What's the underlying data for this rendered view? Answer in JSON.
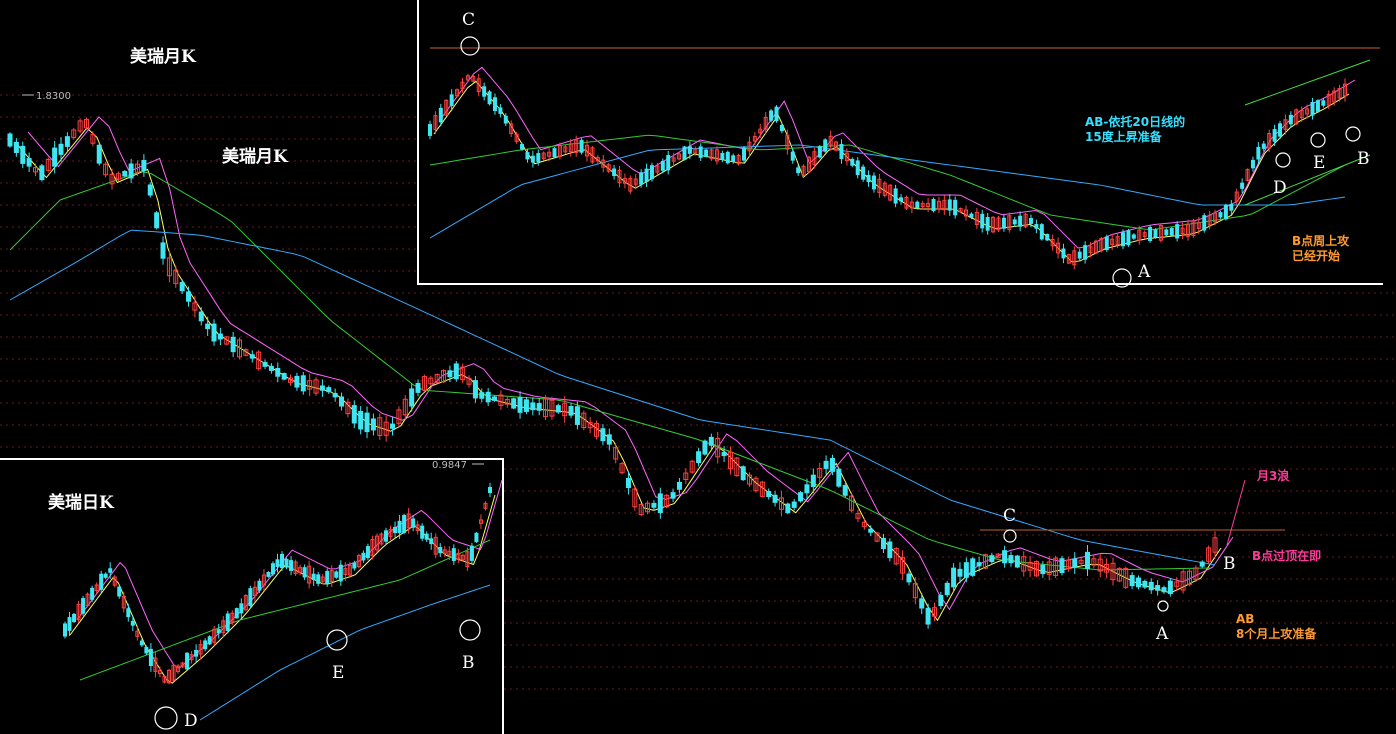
{
  "colors": {
    "background": "#000000",
    "grid": "#6b1a1a",
    "up_candle": "#ff4040",
    "down_candle": "#3fe6f2",
    "ma5": "#ffffff",
    "ma10": "#ffff66",
    "ma20": "#ff66ff",
    "ma30": "#33cc33",
    "ma60": "#33aaff",
    "label_text": "#ffffff",
    "cyan_note": "#33e0ff",
    "orange_note": "#ff9a30",
    "magenta_note": "#ff3a9a",
    "resistance_line": "#c0603a",
    "panel_border": "#ffffff"
  },
  "chart_data": [
    {
      "type": "candlestick",
      "id": "monthly",
      "title": "美瑞月K",
      "title2": "美瑞月K",
      "max_label": "1.8300",
      "grid": true,
      "moving_average_series": [
        "MA5",
        "MA10",
        "MA20",
        "MA30",
        "MA60"
      ],
      "annotations": {
        "C": "C",
        "A": "A",
        "B": "B",
        "wave": "月3浪",
        "breakout": "B点过顶在即",
        "ab_line1": "AB",
        "ab_line2": "8个月上攻准备"
      }
    },
    {
      "type": "candlestick",
      "id": "weekly",
      "grid": false,
      "moving_average_series": [
        "MA5",
        "MA10",
        "MA20",
        "MA30",
        "MA60"
      ],
      "annotations": {
        "C": "C",
        "A": "A",
        "D": "D",
        "E": "E",
        "B": "B",
        "note1_line1": "AB-依托20日线的",
        "note1_line2": "15度上昇准备",
        "note2_line1": "B点周上攻",
        "note2_line2": "已经开始"
      }
    },
    {
      "type": "candlestick",
      "id": "daily",
      "title": "美瑞日K",
      "max_label": "0.9847",
      "grid": false,
      "moving_average_series": [
        "MA5",
        "MA10",
        "MA20",
        "MA30",
        "MA60"
      ],
      "annotations": {
        "D": "D",
        "E": "E",
        "B": "B"
      }
    }
  ]
}
